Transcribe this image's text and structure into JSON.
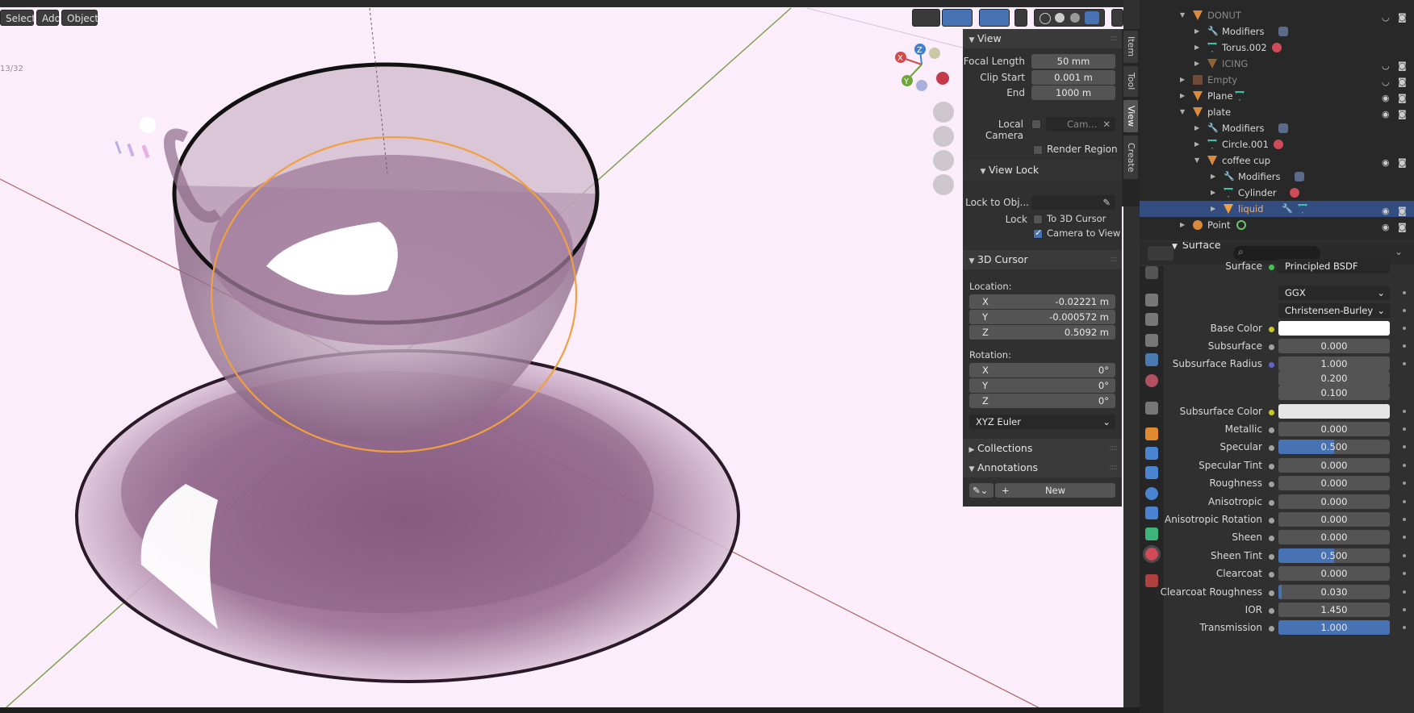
{
  "viewport": {
    "menu": {
      "select": "Select",
      "add": "Add",
      "object": "Object"
    },
    "overlay_text": "13/32",
    "gizmo": {
      "x": "X",
      "y": "Y",
      "z": "Z"
    }
  },
  "npanel": {
    "view_header": "View",
    "focal_length_label": "Focal Length",
    "focal_length": "50 mm",
    "clip_start_label": "Clip Start",
    "clip_start": "0.001 m",
    "clip_end_label": "End",
    "clip_end": "1000 m",
    "local_camera_label": "Local Camera",
    "local_camera_value": "Cam...",
    "render_region_label": "Render Region",
    "view_lock_header": "View Lock",
    "lock_to_obj_label": "Lock to Obj...",
    "lock_label": "Lock",
    "to_3d_cursor_label": "To 3D Cursor",
    "camera_to_view_label": "Camera to View",
    "cursor_header": "3D Cursor",
    "location_label": "Location:",
    "loc": {
      "x": "-0.02221 m",
      "y": "-0.000572 m",
      "z": "0.5092 m"
    },
    "rotation_label": "Rotation:",
    "rot": {
      "x": "0°",
      "y": "0°",
      "z": "0°"
    },
    "axis": {
      "x": "X",
      "y": "Y",
      "z": "Z"
    },
    "rotation_mode": "XYZ Euler",
    "collections_header": "Collections",
    "annotations_header": "Annotations",
    "new_label": "New",
    "tabs": [
      "Item",
      "Tool",
      "View",
      "Create"
    ]
  },
  "outliner": {
    "rows": [
      {
        "name": "DONUT",
        "type": "object",
        "dim": true
      },
      {
        "name": "Modifiers",
        "type": "modifier"
      },
      {
        "name": "Torus.002",
        "type": "mesh"
      },
      {
        "name": "ICING",
        "type": "object",
        "dim": true
      },
      {
        "name": "Empty",
        "type": "empty",
        "dim": true
      },
      {
        "name": "Plane",
        "type": "object"
      },
      {
        "name": "plate",
        "type": "object"
      },
      {
        "name": "Modifiers",
        "type": "modifier"
      },
      {
        "name": "Circle.001",
        "type": "mesh"
      },
      {
        "name": "coffee cup",
        "type": "object"
      },
      {
        "name": "Modifiers",
        "type": "modifier"
      },
      {
        "name": "Cylinder",
        "type": "mesh"
      },
      {
        "name": "liquid",
        "type": "object",
        "selected": true
      },
      {
        "name": "Point",
        "type": "light"
      }
    ]
  },
  "properties": {
    "surface_header": "Surface",
    "surface_label": "Surface",
    "surface_shader": "Principled BSDF",
    "distribution": "GGX",
    "subsurface_method": "Christensen-Burley",
    "base_color_label": "Base Color",
    "base_color": "#ffffff",
    "subsurface_label": "Subsurface",
    "subsurface": "0.000",
    "subsurface_radius_label": "Subsurface Radius",
    "subsurface_radius": [
      "1.000",
      "0.200",
      "0.100"
    ],
    "subsurface_color_label": "Subsurface Color",
    "subsurface_color": "#e6e6e6",
    "params": [
      {
        "label": "Metallic",
        "value": "0.000",
        "fill": 0
      },
      {
        "label": "Specular",
        "value": "0.500",
        "fill": 0.5
      },
      {
        "label": "Specular Tint",
        "value": "0.000",
        "fill": 0
      },
      {
        "label": "Roughness",
        "value": "0.000",
        "fill": 0
      },
      {
        "label": "Anisotropic",
        "value": "0.000",
        "fill": 0
      },
      {
        "label": "Anisotropic Rotation",
        "value": "0.000",
        "fill": 0
      },
      {
        "label": "Sheen",
        "value": "0.000",
        "fill": 0
      },
      {
        "label": "Sheen Tint",
        "value": "0.500",
        "fill": 0.5
      },
      {
        "label": "Clearcoat",
        "value": "0.000",
        "fill": 0
      },
      {
        "label": "Clearcoat Roughness",
        "value": "0.030",
        "fill": 0.03
      },
      {
        "label": "IOR",
        "value": "1.450",
        "fill": 0
      },
      {
        "label": "Transmission",
        "value": "1.000",
        "fill": 1
      }
    ]
  },
  "colors": {
    "accent": "#4772b3",
    "selection": "#334d80",
    "active_outline": "#f0a040"
  }
}
